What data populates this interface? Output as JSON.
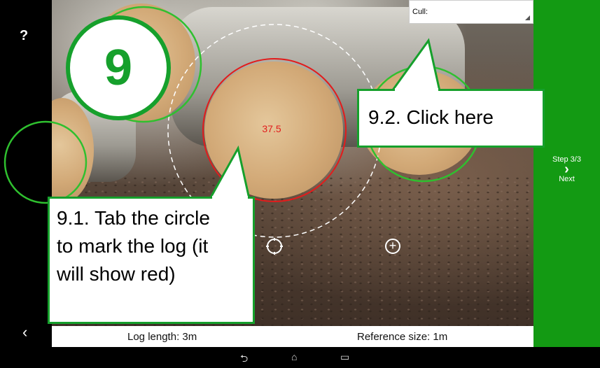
{
  "toolbar": {
    "help_label": "?",
    "back_label": "‹"
  },
  "photo": {
    "measurement": "37.5",
    "cull": {
      "label": "Cull:"
    }
  },
  "controls": {
    "zoom_in_label": "+"
  },
  "next": {
    "step": "Step 3/3",
    "chevron": "›",
    "label": "Next"
  },
  "info": {
    "log_length": "Log length: 3m",
    "reference_size": "Reference size: 1m"
  },
  "nav": {
    "back": "⮌",
    "home": "⌂",
    "recent": "▭"
  },
  "badge": {
    "number": "9"
  },
  "callouts": {
    "step_9_1": "9.1. Tab the circle to mark the log (it will show red)",
    "step_9_2": "9.2. Click here"
  },
  "colors": {
    "accent_green": "#139a13",
    "callout_green": "#16a02c",
    "selected_red": "#e21c1c",
    "unselected_green": "#2fc02f"
  }
}
